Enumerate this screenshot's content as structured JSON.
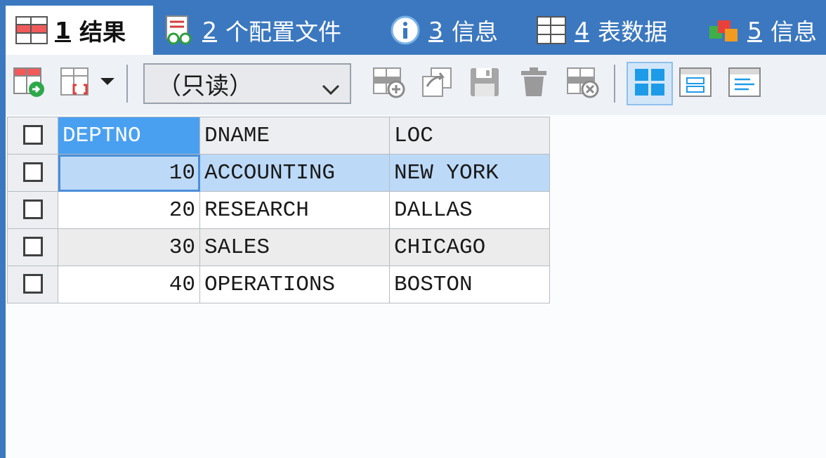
{
  "tabs": [
    {
      "num": "1",
      "label": "结果",
      "icon": "result-grid-icon",
      "active": true
    },
    {
      "num": "2",
      "label": "个配置文件",
      "icon": "profile-icon"
    },
    {
      "num": "3",
      "label": "信息",
      "icon": "info-icon"
    },
    {
      "num": "4",
      "label": "表数据",
      "icon": "table-data-icon"
    },
    {
      "num": "5",
      "label": "信息",
      "icon": "info-stack-icon"
    }
  ],
  "toolbar": {
    "mode_select_value": "（只读）",
    "buttons": [
      "export-icon",
      "import-dropdown-icon",
      "insert-row-icon",
      "duplicate-row-icon",
      "save-icon",
      "delete-icon",
      "discard-icon",
      "grid-view-icon",
      "form-view-icon",
      "text-view-icon"
    ]
  },
  "grid": {
    "columns": [
      "DEPTNO",
      "DNAME",
      "LOC"
    ],
    "rows": [
      [
        "10",
        "ACCOUNTING",
        "NEW YORK"
      ],
      [
        "20",
        "RESEARCH",
        "DALLAS"
      ],
      [
        "30",
        "SALES",
        "CHICAGO"
      ],
      [
        "40",
        "OPERATIONS",
        "BOSTON"
      ]
    ],
    "selected_row": 0,
    "selected_column": "DEPTNO"
  },
  "colors": {
    "accent": "#3c78bf",
    "selection": "#bcd9f7",
    "header_selected": "#4aa0f0"
  }
}
